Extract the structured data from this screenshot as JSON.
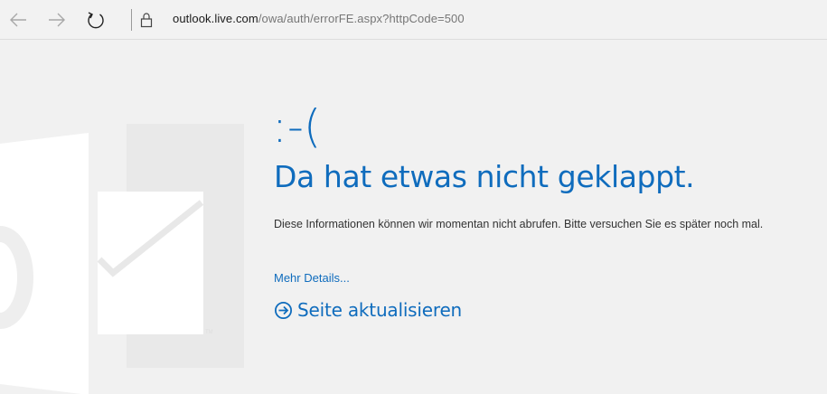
{
  "browser": {
    "url_host": "outlook.live.com",
    "url_path": "/owa/auth/errorFE.aspx?httpCode=500",
    "icons": [
      "back-arrow-icon",
      "forward-arrow-icon",
      "refresh-icon",
      "lock-icon"
    ]
  },
  "error": {
    "face": ":-(",
    "title": "Da hat etwas nicht geklappt.",
    "message": "Diese Informationen können wir momentan nicht abrufen. Bitte versuchen Sie es später noch mal.",
    "details_link": "Mehr Details...",
    "refresh_link": "Seite aktualisieren"
  },
  "colors": {
    "accent": "#0f6cbd",
    "background": "#f1f1f1",
    "text": "#333333"
  }
}
